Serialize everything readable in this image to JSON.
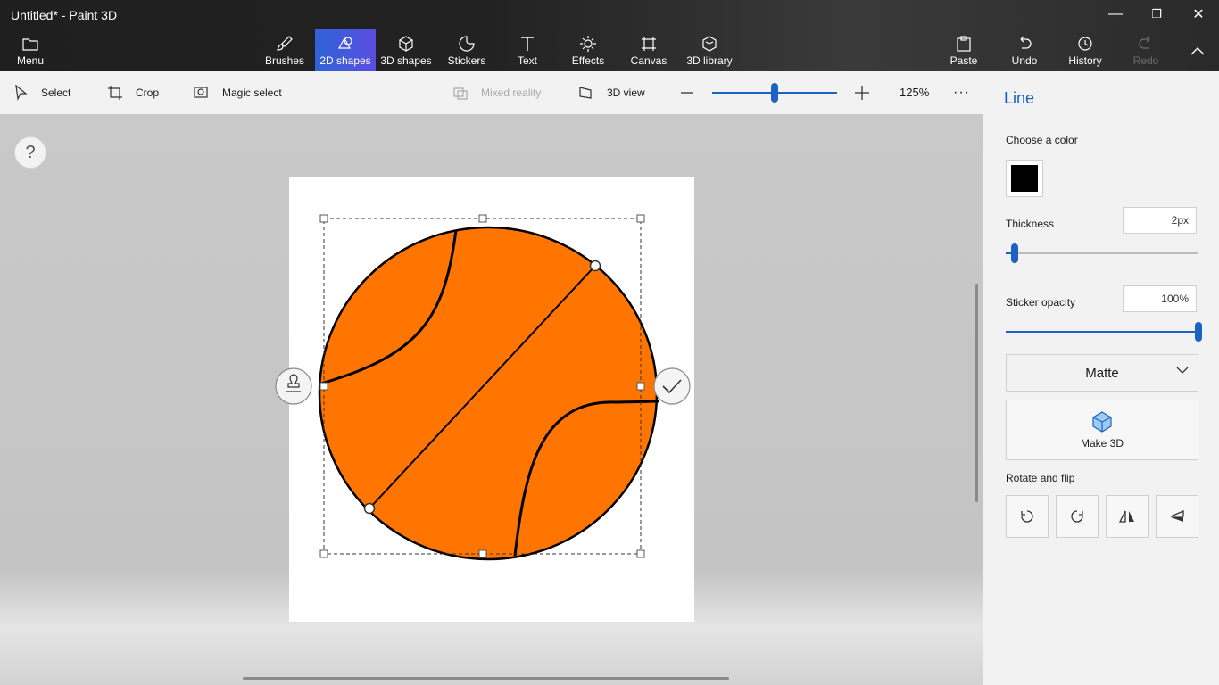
{
  "window": {
    "title": "Untitled* - Paint 3D",
    "minimize": "—",
    "restore": "❐",
    "close": "✕"
  },
  "ribbon": {
    "menu": "Menu",
    "tabs": [
      "Brushes",
      "2D shapes",
      "3D shapes",
      "Stickers",
      "Text",
      "Effects",
      "Canvas",
      "3D library"
    ],
    "active_tab": "2D shapes",
    "right": {
      "paste": "Paste",
      "undo": "Undo",
      "history": "History",
      "redo": "Redo"
    }
  },
  "toolbar": {
    "select": "Select",
    "crop": "Crop",
    "magic_select": "Magic select",
    "mixed_reality": "Mixed reality",
    "view_3d": "3D view",
    "zoom": "125%",
    "zoom_fraction": 0.47,
    "more": "···"
  },
  "workspace": {
    "help": "?"
  },
  "panel": {
    "title": "Line",
    "choose_color": "Choose a color",
    "color": "#000000",
    "thickness_label": "Thickness",
    "thickness_value": "2px",
    "thickness_fraction": 0.03,
    "opacity_label": "Sticker opacity",
    "opacity_value": "100%",
    "opacity_fraction": 1.0,
    "finish": "Matte",
    "make3d": "Make 3D",
    "rotate_flip": "Rotate and flip"
  },
  "colors": {
    "accent": "#1a63c5",
    "shape_fill": "#ff7500",
    "shape_stroke": "#000000"
  }
}
